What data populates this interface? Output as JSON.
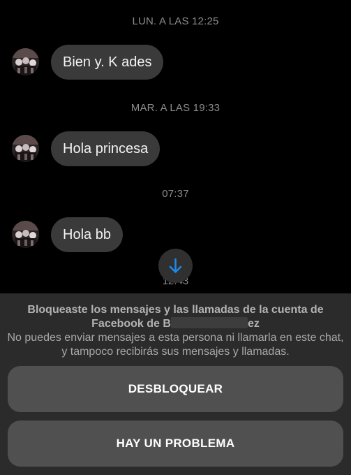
{
  "chat": {
    "messages": [
      {
        "timestamp": "LUN. A LAS 12:25",
        "text": "Bien y. K ades"
      },
      {
        "timestamp": "MAR. A LAS 19:33",
        "text": "Hola princesa"
      },
      {
        "timestamp": "07:37",
        "text": "Hola bb"
      }
    ],
    "partial_timestamp": "12:43"
  },
  "blocked": {
    "title_part1": "Bloqueaste los mensajes y las llamadas de la cuenta de",
    "title_part2": "Facebook de B",
    "title_part3": "ez",
    "description": "No puedes enviar mensajes a esta persona ni llamarla en este chat, y tampoco recibirás sus mensajes y llamadas.",
    "unblock_label": "DESBLOQUEAR",
    "report_label": "HAY UN PROBLEMA"
  },
  "colors": {
    "background": "#000000",
    "bubble": "#3a3a3a",
    "panel": "#2b2b2b",
    "button": "#505050",
    "accent": "#1e88e5"
  }
}
